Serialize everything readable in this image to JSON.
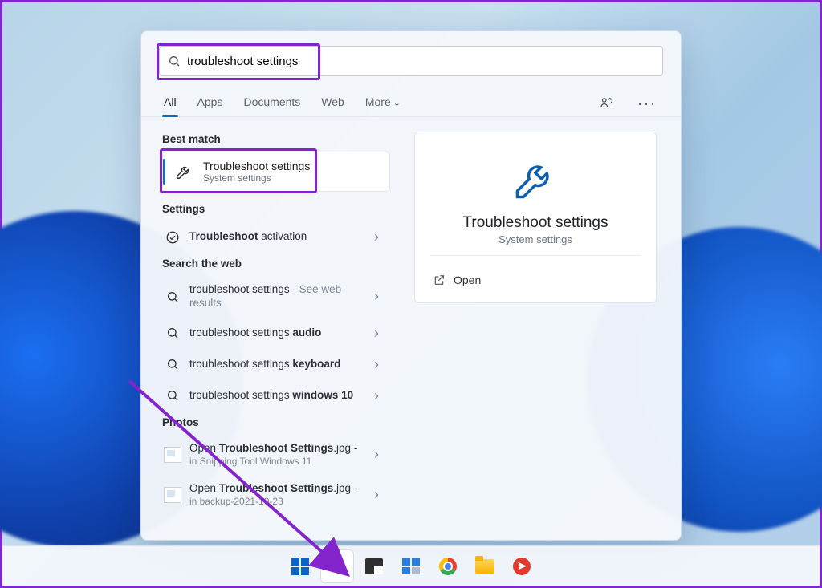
{
  "search": {
    "value": "troubleshoot settings"
  },
  "tabs": {
    "all": "All",
    "apps": "Apps",
    "documents": "Documents",
    "web": "Web",
    "more": "More"
  },
  "sections": {
    "best_match": "Best match",
    "settings": "Settings",
    "search_web": "Search the web",
    "photos": "Photos"
  },
  "best": {
    "title": "Troubleshoot settings",
    "subtitle": "System settings"
  },
  "settings_items": [
    {
      "prefix": "Troubleshoot",
      "suffix": " activation"
    }
  ],
  "web_items": [
    {
      "term": "troubleshoot settings",
      "extra": " - See web results"
    },
    {
      "term": "troubleshoot settings ",
      "bold": "audio"
    },
    {
      "term": "troubleshoot settings ",
      "bold": "keyboard"
    },
    {
      "term": "troubleshoot settings ",
      "bold": "windows 10"
    }
  ],
  "photo_items": [
    {
      "pre": "Open ",
      "name": "Troubleshoot Settings",
      "ext": ".jpg",
      "tail": " -",
      "sub": "in Snipping Tool Windows 11"
    },
    {
      "pre": "Open ",
      "name": "Troubleshoot Settings",
      "ext": ".jpg",
      "tail": " -",
      "sub": "in backup-2021-10-23"
    }
  ],
  "preview": {
    "title": "Troubleshoot settings",
    "subtitle": "System settings",
    "open": "Open"
  }
}
